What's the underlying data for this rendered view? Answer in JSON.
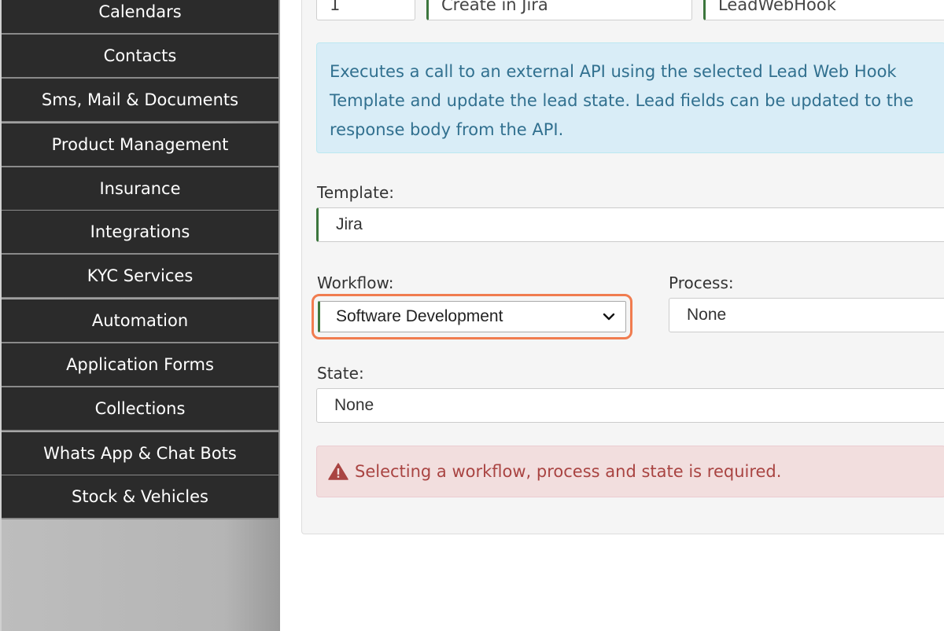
{
  "sidebar": {
    "items": [
      {
        "label": "Calendars"
      },
      {
        "label": "Contacts"
      },
      {
        "label": "Sms, Mail & Documents"
      },
      {
        "label": "Product Management"
      },
      {
        "label": "Insurance"
      },
      {
        "label": "Integrations"
      },
      {
        "label": "KYC Services"
      },
      {
        "label": "Automation"
      },
      {
        "label": "Application Forms"
      },
      {
        "label": "Collections"
      },
      {
        "label": "Whats App & Chat Bots"
      },
      {
        "label": "Stock & Vehicles"
      }
    ]
  },
  "form": {
    "top_fields": [
      "1",
      "Create in Jira",
      "LeadWebHook"
    ],
    "info": "Executes a call to an external API using the selected Lead Web Hook Template and update the lead state. Lead fields can be updated to the response body from the API.",
    "template_label": "Template:",
    "template_value": "Jira",
    "workflow_label": "Workflow:",
    "workflow_value": "Software Development",
    "process_label": "Process:",
    "process_value": "None",
    "state_label": "State:",
    "state_value": "None",
    "error_message": "Selecting a workflow, process and state is required."
  },
  "colors": {
    "sidebar_item_bg": "#2b2b2b",
    "highlight": "#f07c4f",
    "info_text": "#31708f",
    "error_text": "#a94442"
  }
}
